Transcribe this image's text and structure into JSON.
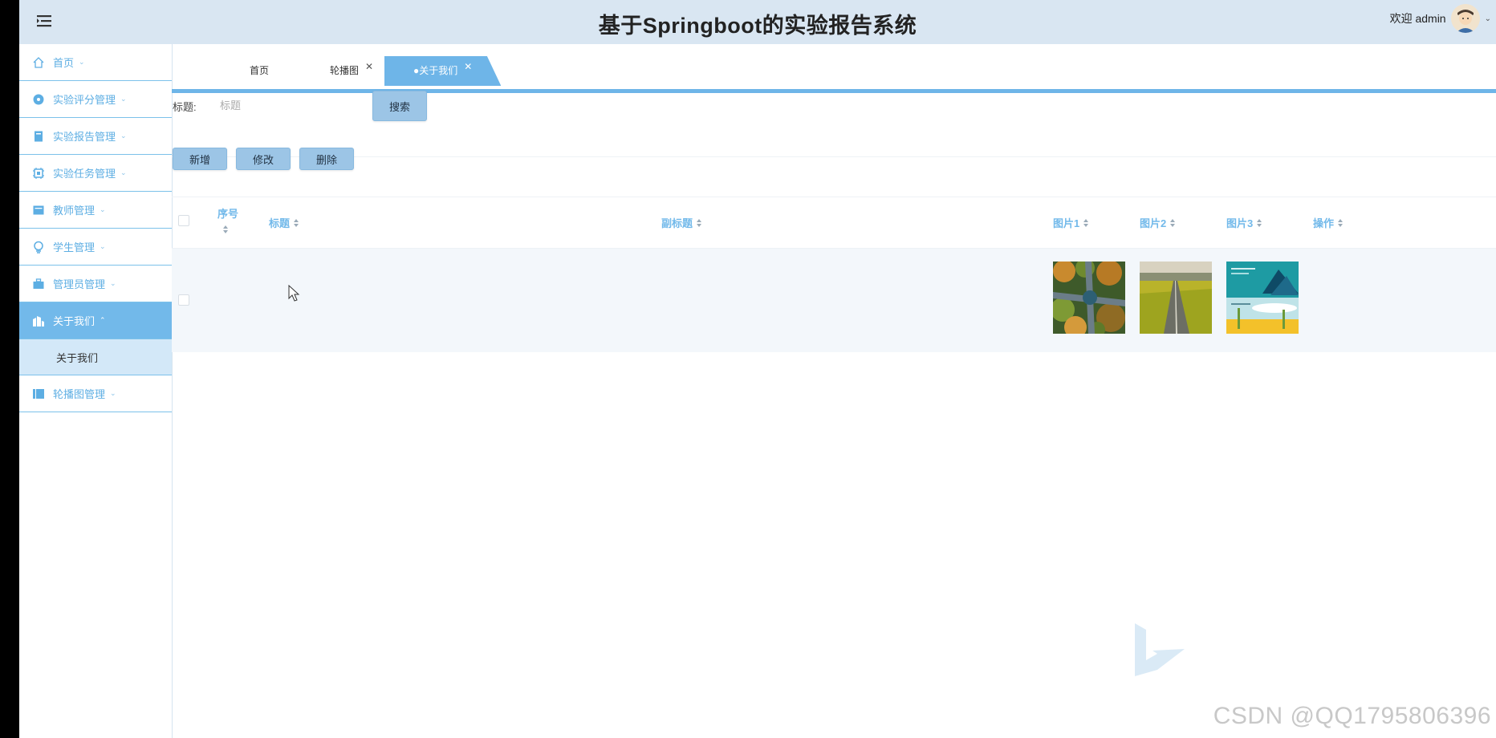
{
  "header": {
    "title": "基于Springboot的实验报告系统",
    "user_greeting": "欢迎 admin"
  },
  "sidebar": {
    "items": [
      {
        "label": "首页",
        "icon": "home-icon"
      },
      {
        "label": "实验评分管理",
        "icon": "score-icon"
      },
      {
        "label": "实验报告管理",
        "icon": "report-icon"
      },
      {
        "label": "实验任务管理",
        "icon": "task-icon"
      },
      {
        "label": "教师管理",
        "icon": "teacher-icon"
      },
      {
        "label": "学生管理",
        "icon": "student-icon"
      },
      {
        "label": "管理员管理",
        "icon": "admin-icon"
      },
      {
        "label": "关于我们",
        "icon": "about-icon",
        "active": true
      },
      {
        "label": "轮播图管理",
        "icon": "carousel-icon"
      }
    ],
    "sub_item": "关于我们"
  },
  "tabs": [
    {
      "label": "首页"
    },
    {
      "label": "轮播图",
      "closable": true
    },
    {
      "label": "●关于我们",
      "closable": true,
      "active": true
    }
  ],
  "search": {
    "label": "标题:",
    "placeholder": "标题",
    "button": "搜索"
  },
  "actions": {
    "add": "新增",
    "edit": "修改",
    "delete": "删除"
  },
  "table": {
    "columns": [
      "序号",
      "标题",
      "副标题",
      "图片1",
      "图片2",
      "图片3",
      "操作"
    ],
    "rows": [
      {
        "index": "",
        "title": "",
        "subtitle": "",
        "images": [
          "forest-road-image",
          "field-road-image",
          "illustration-image"
        ],
        "actions": ""
      }
    ]
  },
  "watermark": "CSDN @QQ1795806396",
  "colors": {
    "header_bg": "#d9e6f2",
    "accent": "#6eb5e8",
    "sidebar_text": "#5daee3",
    "button_bg": "#9cc5e6"
  }
}
